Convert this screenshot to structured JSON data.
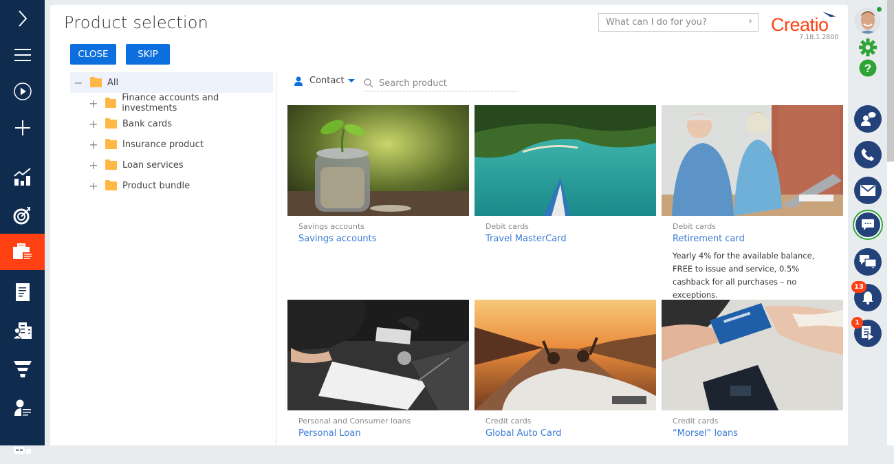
{
  "left_nav": {
    "items": [
      {
        "name": "expand",
        "icon": "chevron-right-icon"
      },
      {
        "name": "menu",
        "icon": "hamburger-menu-icon"
      },
      {
        "name": "processes",
        "icon": "play-circle-icon"
      },
      {
        "name": "add",
        "icon": "plus-icon"
      },
      {
        "name": "dashboards",
        "icon": "chart-icon"
      },
      {
        "name": "leads",
        "icon": "target-icon"
      },
      {
        "name": "products",
        "icon": "briefcase-icon",
        "active": true
      },
      {
        "name": "documents",
        "icon": "document-icon"
      },
      {
        "name": "accounts",
        "icon": "building-contact-icon"
      },
      {
        "name": "funnel",
        "icon": "funnel-icon"
      },
      {
        "name": "contacts",
        "icon": "contact-list-icon"
      },
      {
        "name": "more",
        "icon": "building-icon"
      }
    ],
    "active_color": "#ff4013",
    "bg_color": "#0f2c4f"
  },
  "header": {
    "title": "Product selection",
    "close_label": "CLOSE",
    "skip_label": "SKIP",
    "command_placeholder": "What can I do for you?",
    "logo_text": "Creatio",
    "version": "7.18.1.2800"
  },
  "tree": {
    "root": "All",
    "children": [
      "Finance accounts and investments",
      "Bank cards",
      "Insurance product",
      "Loan services",
      "Product bundle"
    ]
  },
  "toolbar": {
    "filter_label": "Contact",
    "search_placeholder": "Search product"
  },
  "products": [
    {
      "category": "Savings accounts",
      "name": "Savings accounts",
      "description": "",
      "image": "coin jar with plant"
    },
    {
      "category": "Debit cards",
      "name": "Travel MasterCard",
      "description": "",
      "image": "boat on turquoise sea"
    },
    {
      "category": "Debit cards",
      "name": "Retirement card",
      "description": "Yearly 4% for the available balance, FREE to issue and service, 0.5% cashback for all purchases – no exceptions.",
      "image": "senior couple with laptop"
    },
    {
      "category": "Personal and Consumer loans",
      "name": "Personal Loan",
      "description": "",
      "image": "signing contract with car keys"
    },
    {
      "category": "Credit cards",
      "name": "Global Auto Card",
      "description": "",
      "image": "convertible at sunset"
    },
    {
      "category": "Credit cards",
      "name": "“Morsel” loans",
      "description": "",
      "image": "handing over credit card"
    }
  ],
  "right_bar": {
    "notifications_count": "13",
    "tasks_count": "1",
    "accent_green": "#2fa436",
    "circle_color": "#23427a"
  }
}
